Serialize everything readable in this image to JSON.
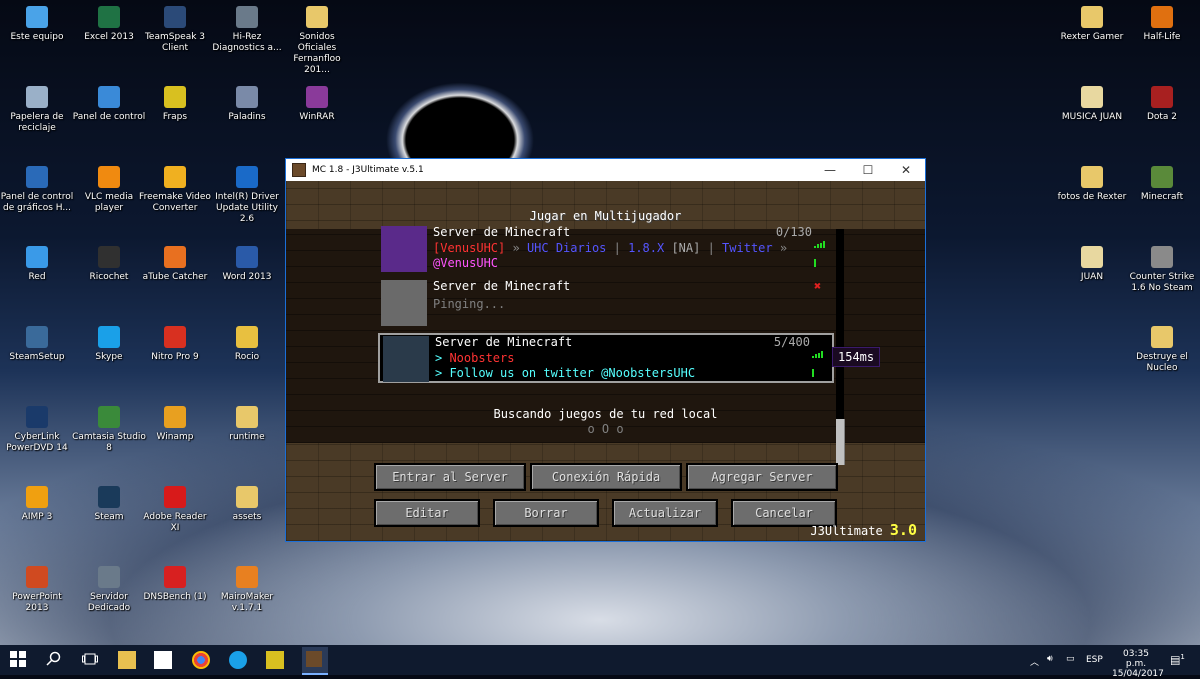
{
  "desktop": {
    "icons": [
      {
        "label": "Este equipo",
        "color": "#4aa3e8"
      },
      {
        "label": "Excel 2013",
        "color": "#1f7244"
      },
      {
        "label": "TeamSpeak 3 Client",
        "color": "#2b4a78"
      },
      {
        "label": "Hi-Rez Diagnostics a...",
        "color": "#6a7a8a"
      },
      {
        "label": "Sonidos Oficiales Fernanfloo 201...",
        "color": "#e8c86a"
      },
      {
        "label": "Papelera de reciclaje",
        "color": "#9ab0c8"
      },
      {
        "label": "Panel de control",
        "color": "#3a8ad8"
      },
      {
        "label": "Fraps",
        "color": "#d8c020"
      },
      {
        "label": "Paladins",
        "color": "#7a8aa8"
      },
      {
        "label": "WinRAR",
        "color": "#8a3a9a"
      },
      {
        "label": "Panel de control de gráficos H...",
        "color": "#2a6ab8"
      },
      {
        "label": "VLC media player",
        "color": "#f08a10"
      },
      {
        "label": "Freemake Video Converter",
        "color": "#f0b020"
      },
      {
        "label": "Intel(R) Driver Update Utility 2.6",
        "color": "#1a6ac8"
      },
      {
        "label": "Red",
        "color": "#3a9ae8"
      },
      {
        "label": "Ricochet",
        "color": "#303030"
      },
      {
        "label": "aTube Catcher",
        "color": "#e87020"
      },
      {
        "label": "Word 2013",
        "color": "#2a5aa8"
      },
      {
        "label": "SteamSetup",
        "color": "#3a6a9a"
      },
      {
        "label": "Skype",
        "color": "#1aa0e8"
      },
      {
        "label": "Nitro Pro 9",
        "color": "#d83020"
      },
      {
        "label": "Rocio",
        "color": "#e8c040"
      },
      {
        "label": "CyberLink PowerDVD 14",
        "color": "#1a3a6a"
      },
      {
        "label": "Camtasia Studio 8",
        "color": "#3a8a3a"
      },
      {
        "label": "Winamp",
        "color": "#e8a020"
      },
      {
        "label": "runtime",
        "color": "#e8c86a"
      },
      {
        "label": "AIMP 3",
        "color": "#f0a010"
      },
      {
        "label": "Steam",
        "color": "#1a3a5a"
      },
      {
        "label": "Adobe Reader XI",
        "color": "#d81a1a"
      },
      {
        "label": "assets",
        "color": "#e8c86a"
      },
      {
        "label": "PowerPoint 2013",
        "color": "#d04a20"
      },
      {
        "label": "Servidor Dedicado",
        "color": "#6a7a8a"
      },
      {
        "label": "DNSBench (1)",
        "color": "#d82020"
      },
      {
        "label": "MairoMaker v.1.7.1",
        "color": "#e88020"
      },
      {
        "label": "Rexter Gamer",
        "color": "#e8c86a"
      },
      {
        "label": "Half-Life",
        "color": "#e07010"
      },
      {
        "label": "MUSICA JUAN",
        "color": "#e8d8a0"
      },
      {
        "label": "Dota 2",
        "color": "#a82020"
      },
      {
        "label": "fotos de Rexter",
        "color": "#e8c86a"
      },
      {
        "label": "Minecraft",
        "color": "#5a8a3a"
      },
      {
        "label": "JUAN",
        "color": "#e8d8a0"
      },
      {
        "label": "Counter Strike 1.6 No Steam",
        "color": "#8a8a8a"
      },
      {
        "label": "Destruye el Nucleo",
        "color": "#e8c86a"
      }
    ]
  },
  "window": {
    "title": "MC 1.8 - J3Ultimate v.5.1",
    "controls": {
      "minimize": "—",
      "maximize": "☐",
      "close": "✕"
    }
  },
  "screen": {
    "heading": "Jugar en Multijugador",
    "servers": [
      {
        "name": "Server de Minecraft",
        "count": "0/130",
        "motd_line1": [
          {
            "t": "[VenusUHC]",
            "c": "#ff3333"
          },
          {
            "t": " » ",
            "c": "#888888"
          },
          {
            "t": "UHC Diarios",
            "c": "#5555ff"
          },
          {
            "t": " | ",
            "c": "#888888"
          },
          {
            "t": "1.8.X",
            "c": "#5555ff"
          },
          {
            "t": " [NA] ",
            "c": "#aaaaaa"
          },
          {
            "t": "|",
            "c": "#888888"
          },
          {
            "t": " Twitter",
            "c": "#5555ff"
          },
          {
            "t": " »",
            "c": "#888888"
          }
        ],
        "motd_line2": [
          {
            "t": "@VenusUHC",
            "c": "#ff55ff"
          }
        ],
        "icon_color": "#5a2a8a"
      },
      {
        "name": "Server de Minecraft",
        "count": "",
        "motd_line1": [
          {
            "t": "Pinging...",
            "c": "#808080"
          }
        ],
        "motd_line2": [],
        "icon_color": "#6a6a6a"
      },
      {
        "name": "Server de Minecraft",
        "count": "5/400",
        "motd_line1": [
          {
            "t": "> ",
            "c": "#55ffff"
          },
          {
            "t": "Noobsters",
            "c": "#ff3333"
          }
        ],
        "motd_line2": [
          {
            "t": "> Follow us on twitter ",
            "c": "#55ffff"
          },
          {
            "t": "@NoobstersUHC",
            "c": "#55ffff"
          }
        ],
        "icon_color": "#2a3a4a"
      }
    ],
    "ping_tooltip": "154ms",
    "lan_title": "Buscando juegos de tu red local",
    "lan_anim": "o O o",
    "buttons_row1": [
      "Entrar al Server",
      "Conexión Rápida",
      "Agregar Server"
    ],
    "buttons_row2": [
      "Editar",
      "Borrar",
      "Actualizar",
      "Cancelar"
    ],
    "brand_text": "J3Ultimate",
    "brand_version": "3.0"
  },
  "taskbar": {
    "language": "ESP",
    "time": "03:35 p.m.",
    "date": "15/04/2017",
    "notification_count": "1"
  }
}
